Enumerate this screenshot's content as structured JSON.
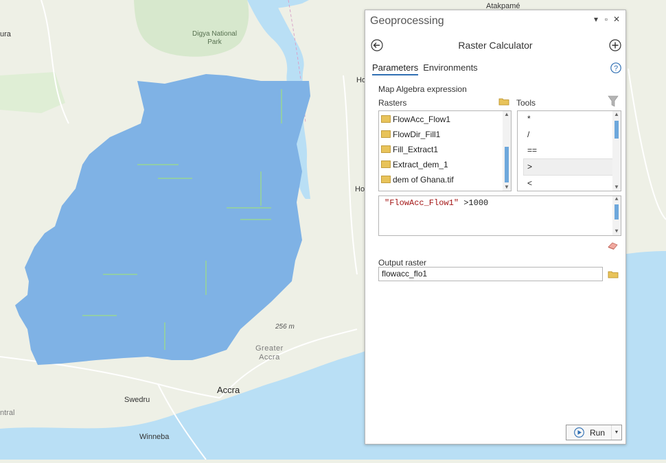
{
  "map": {
    "labels": {
      "park": [
        "Digya National",
        "Park"
      ],
      "atakpame": "Atakpamé",
      "greater_accra": [
        "Greater",
        "Accra"
      ],
      "accra": "Accra",
      "swedru": "Swedru",
      "winneba": "Winneba",
      "elevation": "256 m",
      "edge_left_top": "ura",
      "edge_left_bottom": "ntral",
      "edge_right_1": "Ho",
      "edge_right_2": "Ho"
    },
    "colors": {
      "land": "#eef0e6",
      "water": "#b9dff5",
      "raster": "#7fb2e5",
      "park": "#d7e8cd"
    }
  },
  "panel": {
    "title": "Geoprocessing",
    "tool_title": "Raster Calculator",
    "tabs": [
      "Parameters",
      "Environments"
    ],
    "active_tab": "Parameters",
    "map_algebra_label": "Map Algebra expression",
    "rasters_label": "Rasters",
    "tools_label": "Tools",
    "rasters": [
      "FlowAcc_Flow1",
      "FlowDir_Fill1",
      "Fill_Extract1",
      "Extract_dem_1",
      "dem of Ghana.tif"
    ],
    "tools": [
      "*",
      "/",
      "==",
      ">",
      "<"
    ],
    "selected_tool": ">",
    "expression": {
      "string": "\"FlowAcc_Flow1\"",
      "rest": " >1000"
    },
    "output_label": "Output raster",
    "output_value": "flowacc_flo1",
    "run_label": "Run",
    "icons": [
      "back-arrow-icon",
      "add-icon",
      "help-icon",
      "folder-icon",
      "filter-icon",
      "eraser-icon",
      "play-icon"
    ],
    "accent_color": "#2f6fb3"
  }
}
